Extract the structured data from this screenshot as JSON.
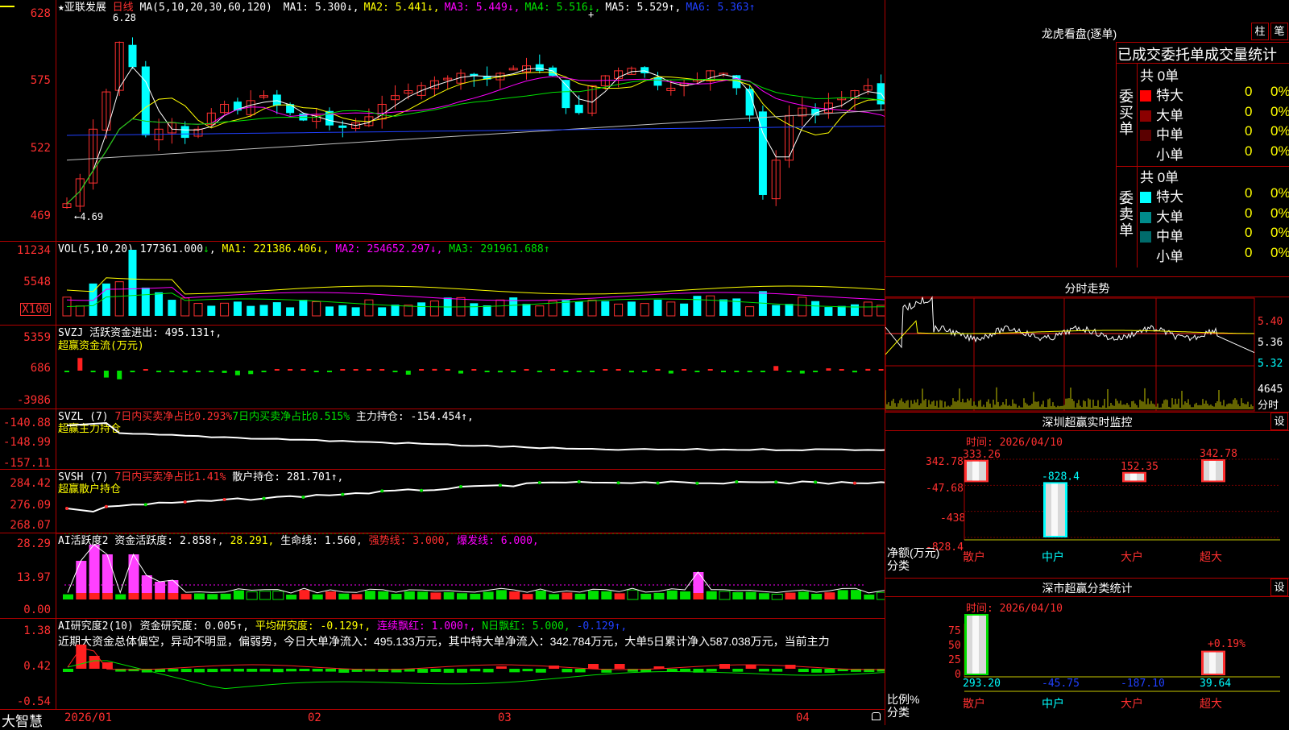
{
  "stock": {
    "name": "亚联发展",
    "period": "日线",
    "star": "★"
  },
  "main_pane": {
    "ma_title": "MA(5,10,20,30,60,120)",
    "ma": [
      {
        "label": "MA1:",
        "value": "5.300",
        "arrow": "↓",
        "color": "#ffffff"
      },
      {
        "label": "MA2:",
        "value": "5.441",
        "arrow": "↓",
        "color": "#ffff00"
      },
      {
        "label": "MA3:",
        "value": "5.449",
        "arrow": "↓",
        "color": "#ff00ff"
      },
      {
        "label": "MA4:",
        "value": "5.516",
        "arrow": "↓",
        "color": "#00e000"
      },
      {
        "label": "MA5:",
        "value": "5.529",
        "arrow": "↑",
        "color": "#ffffff"
      },
      {
        "label": "MA6:",
        "value": "5.363",
        "arrow": "↑",
        "color": "#2040ff"
      }
    ],
    "y_labels": [
      "628",
      "575",
      "522",
      "469"
    ],
    "high_mark": "6.28",
    "low_mark": "←4.69"
  },
  "vol_pane": {
    "title": "VOL(5,10,20)",
    "value": "177361.000",
    "value_arrow": "↓",
    "ma1": "MA1: 221386.406↓,",
    "ma2": "MA2: 254652.297↓,",
    "ma3": "MA3: 291961.688↑",
    "y_labels": [
      "11234",
      "5548"
    ],
    "unit": "X100"
  },
  "svzj_pane": {
    "title": "SVZJ  活跃资金进出: 495.131↑,",
    "subtitle": "超赢资金流(万元)",
    "y_labels": [
      "5359",
      "686",
      "-3986"
    ]
  },
  "svzl_pane": {
    "title_a": "SVZL (7)",
    "title_b": "7日内买卖净占比0.293%",
    "title_c": "7日内买卖净占比0.515%",
    "title_d": "主力持仓: -154.454↑,",
    "subtitle": "超赢主力持仓",
    "y_labels": [
      "-140.88",
      "-148.99",
      "-157.11"
    ]
  },
  "svsh_pane": {
    "title_a": "SVSH (7)",
    "title_b": "7日内买卖净占比1.41%",
    "title_c": "散户持仓: 281.701↑,",
    "subtitle": "超赢散户持仓",
    "y_labels": [
      "284.42",
      "276.09",
      "268.07"
    ]
  },
  "ai2_pane": {
    "title_a": "AI活跃度2 资金活跃度: 2.858↑,",
    "title_b": "28.291,",
    "title_c": "生命线: 1.560,",
    "title_d": "强势线: 3.000,",
    "title_e": "爆发线: 6.000,",
    "y_labels": [
      "28.29",
      "13.97",
      "0.00"
    ]
  },
  "ai_research_pane": {
    "title_a": "AI研究度2(10) 资金研究度: 0.005↑,",
    "title_b": "平均研究度: -0.129↑,",
    "title_c": "连续飘红: 1.000↑,",
    "title_d": "N日飘红: 5.000,",
    "title_e": "-0.129↑,",
    "comment": "近期大资金总体偏空，异动不明显，偏弱势，今日大单净流入：495.133万元，其中特大单净流入：342.784万元，大单5日累计净入587.038万元，当前主力",
    "y_labels": [
      "1.38",
      "0.42",
      "-0.54"
    ]
  },
  "x_axis": {
    "labels": [
      "2026/01",
      "02",
      "03",
      "04"
    ],
    "brand": "大智慧"
  },
  "lhb": {
    "title": "龙虎看盘(逐单)",
    "btn1": "柱",
    "btn2": "笔",
    "subtitle": "已成交委托单成交量统计",
    "buy_label": "委买单",
    "sell_label": "委卖单",
    "buy_total": "共 0单",
    "sell_total": "共 0单",
    "buy_rows": [
      {
        "name": "特大",
        "count": "0",
        "pct": "0%",
        "color": "#ff0000"
      },
      {
        "name": "大单",
        "count": "0",
        "pct": "0%",
        "color": "#8b0000"
      },
      {
        "name": "中单",
        "count": "0",
        "pct": "0%",
        "color": "#5a0000"
      },
      {
        "name": "小单",
        "count": "0",
        "pct": "0%",
        "color": ""
      }
    ],
    "sell_rows": [
      {
        "name": "特大",
        "count": "0",
        "pct": "0%",
        "color": "#00ffff"
      },
      {
        "name": "大单",
        "count": "0",
        "pct": "0%",
        "color": "#008b8b"
      },
      {
        "name": "中单",
        "count": "0",
        "pct": "0%",
        "color": "#006b6b"
      },
      {
        "name": "小单",
        "count": "0",
        "pct": "0%",
        "color": ""
      }
    ]
  },
  "fenshi": {
    "title": "分时走势",
    "y_labels": [
      "5.40",
      "5.36",
      "5.32"
    ],
    "vol_label": "4645",
    "vol_unit": "分时"
  },
  "sz_monitor": {
    "title": "深圳超赢实时监控",
    "btn": "设",
    "time": "时间: 2026/04/10",
    "y_labels": [
      "342.78",
      "-47.68",
      "-438",
      "-828.4"
    ],
    "y_unit": "净额(万元)",
    "y_unit2": "分类",
    "chart_data": {
      "type": "bar",
      "categories": [
        "散户",
        "中户",
        "大户",
        "超大"
      ],
      "values": [
        333.26,
        -828.4,
        152.35,
        342.78
      ],
      "value_labels": [
        "333.26",
        "-828.4",
        "152.35",
        "342.78"
      ],
      "ylim": [
        -828.4,
        342.78
      ]
    }
  },
  "sz_class": {
    "title": "深市超赢分类统计",
    "btn": "设",
    "time": "时间: 2026/04/10",
    "y_labels": [
      "75",
      "50",
      "25",
      "0"
    ],
    "y_unit": "比例%",
    "y_unit2": "分类",
    "pct_label": "+0.19%",
    "chart_data": {
      "type": "bar",
      "categories": [
        "散户",
        "中户",
        "大户",
        "超大"
      ],
      "values": [
        293.2,
        -45.75,
        -187.1,
        39.64
      ],
      "value_labels": [
        "293.20",
        "-45.75",
        "-187.10",
        "39.64"
      ],
      "bar_pct": [
        100,
        0,
        0,
        40
      ]
    }
  }
}
